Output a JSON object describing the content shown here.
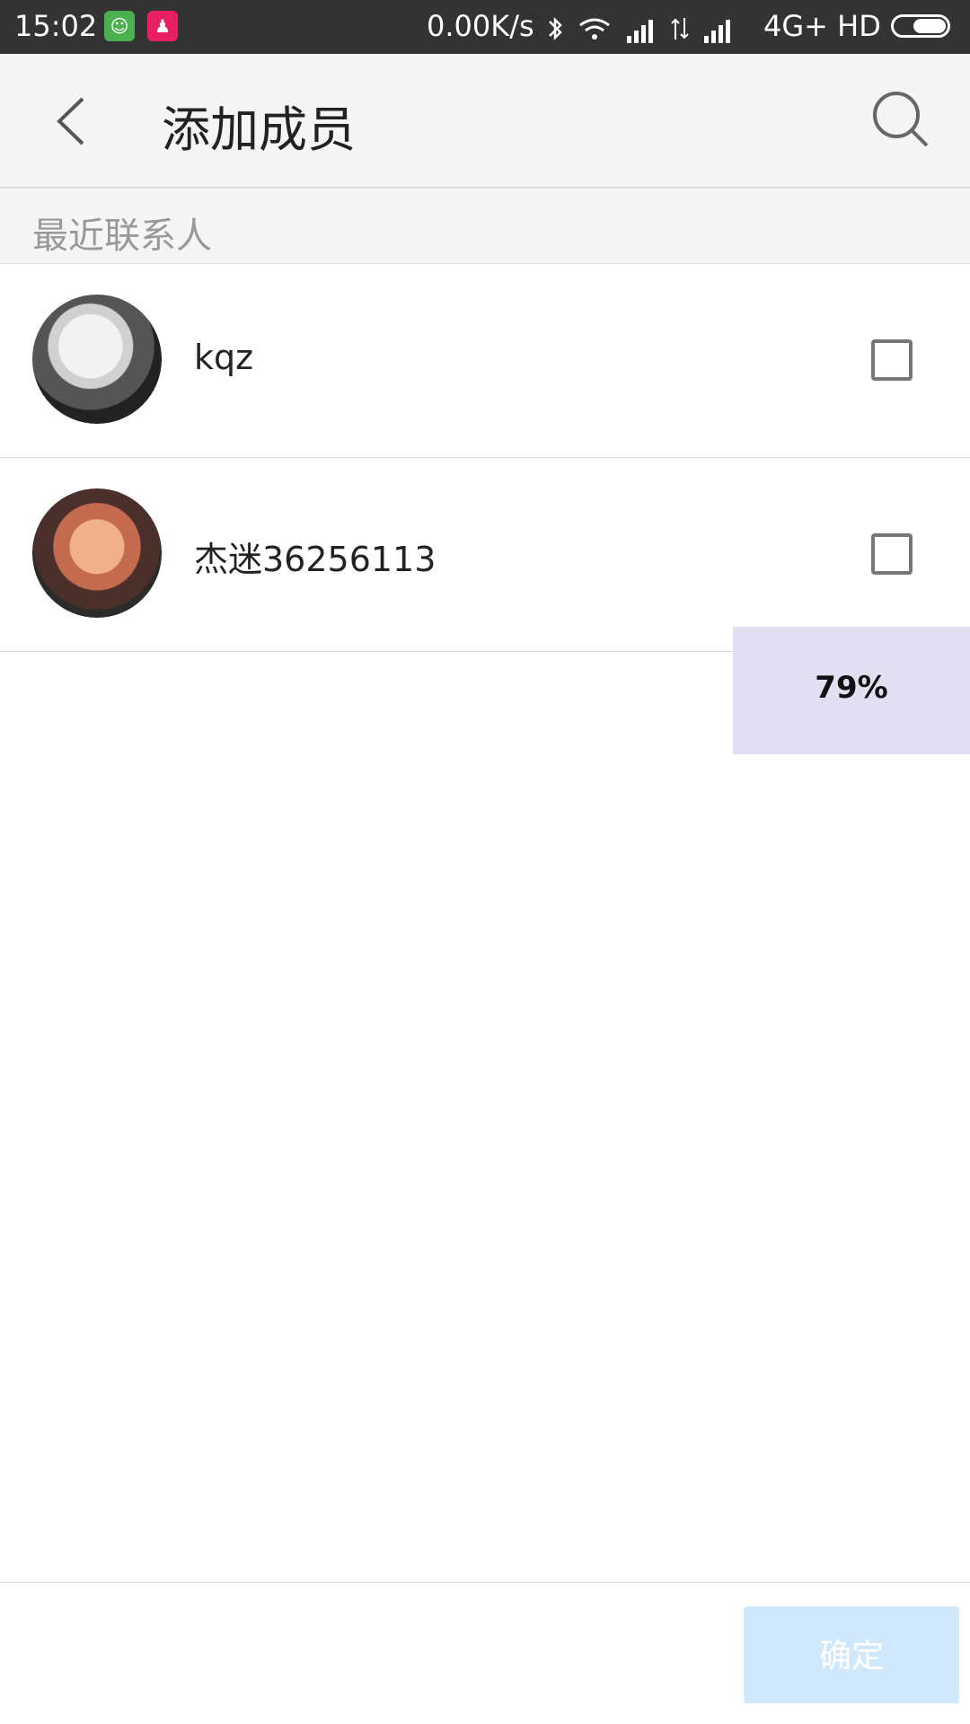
{
  "status_bar": {
    "time": "15:02",
    "net_speed": "0.00K/s",
    "network_text": "4G+ HD",
    "icons": [
      "app-notification-icon",
      "app-notification-icon",
      "bluetooth-icon",
      "wifi-icon",
      "signal-icon",
      "data-arrows-icon",
      "signal-icon",
      "battery-icon"
    ]
  },
  "header": {
    "title": "添加成员",
    "back_icon": "chevron-left-icon",
    "search_icon": "search-icon"
  },
  "section": {
    "label": "最近联系人"
  },
  "contacts": [
    {
      "name": "kqz",
      "checked": false
    },
    {
      "name": "杰迷36256113",
      "checked": false
    }
  ],
  "overlay": {
    "progress_text": "79%"
  },
  "footer": {
    "confirm_label": "确定"
  },
  "colors": {
    "status_bar": "#333333",
    "app_bar": "#f5f5f5",
    "confirm_disabled": "#cfe8fb",
    "overlay": "#e1dff1"
  }
}
